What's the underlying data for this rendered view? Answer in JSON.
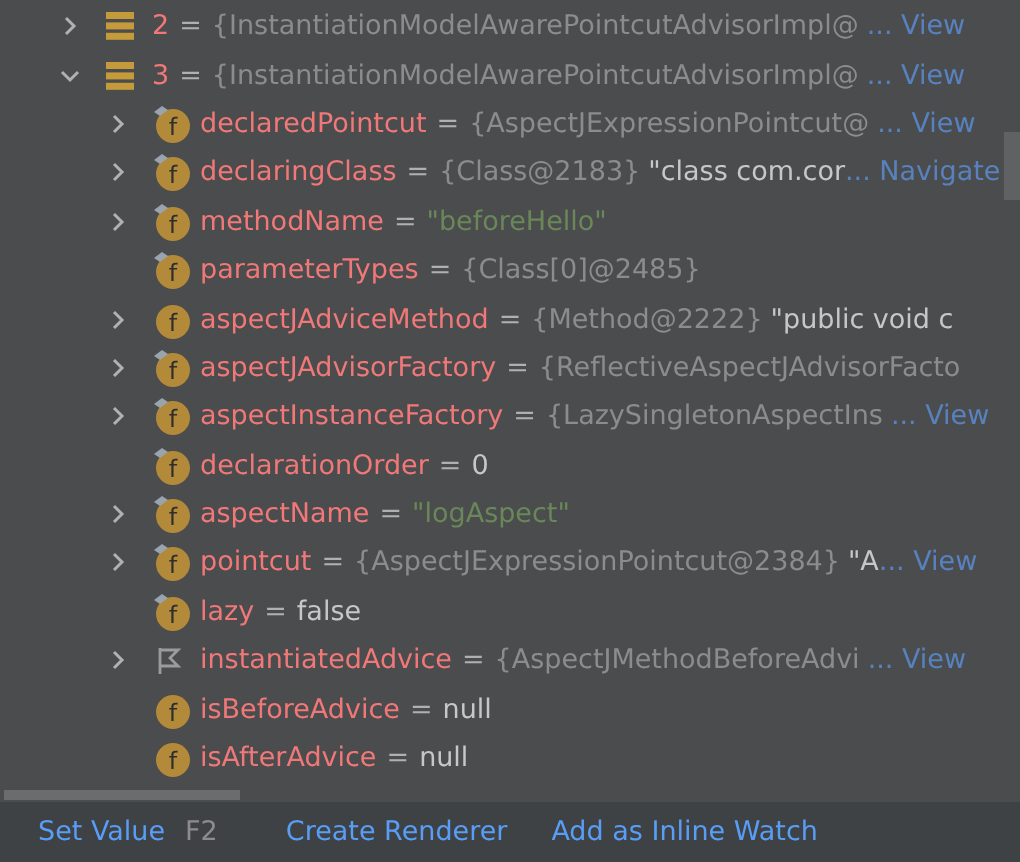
{
  "variables": [
    {
      "name": "2",
      "kind": "array",
      "operator": "=",
      "expanded": false,
      "value": [
        {
          "kind": "type",
          "text": "{InstantiationModelAwarePointcutAdvisorImpl@"
        },
        {
          "kind": "link",
          "text": "... View"
        }
      ]
    },
    {
      "name": "3",
      "kind": "array",
      "operator": "=",
      "expanded": true,
      "value": [
        {
          "kind": "type",
          "text": "{InstantiationModelAwarePointcutAdvisorImpl@"
        },
        {
          "kind": "link",
          "text": "... View"
        }
      ],
      "children": [
        {
          "name": "declaredPointcut",
          "kind": "final_field",
          "badge": "f",
          "operator": "=",
          "expanded": false,
          "value": [
            {
              "kind": "type",
              "text": "{AspectJExpressionPointcut@"
            },
            {
              "kind": "link",
              "text": "... View"
            }
          ]
        },
        {
          "name": "declaringClass",
          "kind": "final_field",
          "badge": "f",
          "operator": "=",
          "expanded": false,
          "value": [
            {
              "kind": "type",
              "text": "{Class@2183}"
            },
            {
              "kind": "plain",
              "text": "\"class com.cor"
            },
            {
              "kind": "link",
              "text": "... Navigate"
            }
          ]
        },
        {
          "name": "methodName",
          "kind": "final_field",
          "badge": "f",
          "operator": "=",
          "expanded": false,
          "value": [
            {
              "kind": "string",
              "text": "\"beforeHello\""
            }
          ]
        },
        {
          "name": "parameterTypes",
          "kind": "final_field",
          "badge": "f",
          "operator": "=",
          "value": [
            {
              "kind": "type",
              "text": "{Class[0]@2485}"
            }
          ]
        },
        {
          "name": "aspectJAdviceMethod",
          "kind": "field",
          "badge": "f",
          "operator": "=",
          "expanded": false,
          "value": [
            {
              "kind": "type",
              "text": "{Method@2222}"
            },
            {
              "kind": "plain",
              "text": "\"public void c"
            }
          ]
        },
        {
          "name": "aspectJAdvisorFactory",
          "kind": "final_field",
          "badge": "f",
          "operator": "=",
          "expanded": false,
          "value": [
            {
              "kind": "type",
              "text": "{ReflectiveAspectJAdvisorFacto"
            }
          ]
        },
        {
          "name": "aspectInstanceFactory",
          "kind": "final_field",
          "badge": "f",
          "operator": "=",
          "expanded": false,
          "value": [
            {
              "kind": "type",
              "text": "{LazySingletonAspectIns"
            },
            {
              "kind": "link",
              "text": "... View"
            }
          ]
        },
        {
          "name": "declarationOrder",
          "kind": "final_field",
          "badge": "f",
          "operator": "=",
          "value": [
            {
              "kind": "plain",
              "text": "0"
            }
          ]
        },
        {
          "name": "aspectName",
          "kind": "final_field",
          "badge": "f",
          "operator": "=",
          "expanded": false,
          "value": [
            {
              "kind": "string",
              "text": "\"logAspect\""
            }
          ]
        },
        {
          "name": "pointcut",
          "kind": "final_field",
          "badge": "f",
          "operator": "=",
          "expanded": false,
          "value": [
            {
              "kind": "type",
              "text": "{AspectJExpressionPointcut@2384}"
            },
            {
              "kind": "plain",
              "text": "\"A"
            },
            {
              "kind": "link",
              "text": "... View"
            }
          ]
        },
        {
          "name": "lazy",
          "kind": "final_field",
          "badge": "f",
          "operator": "=",
          "value": [
            {
              "kind": "plain",
              "text": "false"
            }
          ]
        },
        {
          "name": "instantiatedAdvice",
          "kind": "flag",
          "operator": "=",
          "expanded": false,
          "value": [
            {
              "kind": "type",
              "text": "{AspectJMethodBeforeAdvi"
            },
            {
              "kind": "link",
              "text": "... View"
            }
          ]
        },
        {
          "name": "isBeforeAdvice",
          "kind": "field",
          "badge": "f",
          "operator": "=",
          "value": [
            {
              "kind": "plain",
              "text": "null"
            }
          ]
        },
        {
          "name": "isAfterAdvice",
          "kind": "field",
          "badge": "f",
          "operator": "=",
          "value": [
            {
              "kind": "plain",
              "text": "null"
            }
          ]
        }
      ]
    }
  ],
  "actions": [
    {
      "label": "Set Value",
      "shortcut": "F2"
    },
    {
      "label": "Create Renderer"
    },
    {
      "label": "Add as Inline Watch"
    }
  ]
}
